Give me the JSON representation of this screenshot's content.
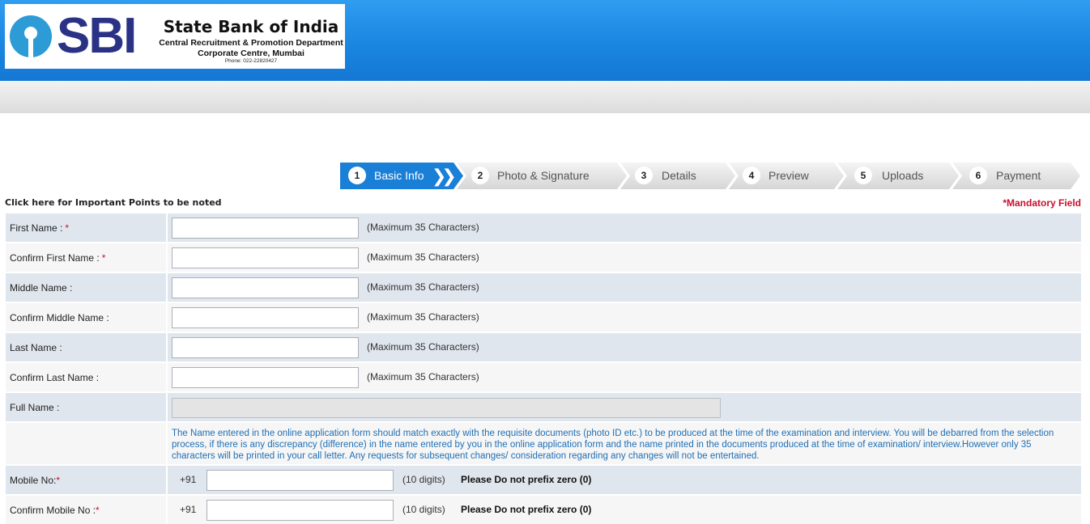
{
  "header": {
    "logo_text": "SBI",
    "bank_name": "State Bank of India",
    "department": "Central Recruitment & Promotion Department",
    "office": "Corporate Centre, Mumbai",
    "phone": "Phone: 022-22820427"
  },
  "steps": [
    {
      "num": "1",
      "label": "Basic Info",
      "active": true
    },
    {
      "num": "2",
      "label": "Photo & Signature",
      "active": false
    },
    {
      "num": "3",
      "label": "Details",
      "active": false
    },
    {
      "num": "4",
      "label": "Preview",
      "active": false
    },
    {
      "num": "5",
      "label": "Uploads",
      "active": false
    },
    {
      "num": "6",
      "label": "Payment",
      "active": false
    }
  ],
  "important_link": "Click here for Important Points to be noted",
  "mandatory_note": "*Mandatory Field",
  "form": {
    "first_name": {
      "label": "First Name :",
      "req": "*",
      "hint": "(Maximum 35 Characters)",
      "value": ""
    },
    "confirm_first_name": {
      "label": "Confirm First Name :",
      "req": "*",
      "hint": "(Maximum 35 Characters)",
      "value": ""
    },
    "middle_name": {
      "label": "Middle Name :",
      "hint": "(Maximum 35 Characters)",
      "value": ""
    },
    "confirm_middle_name": {
      "label": "Confirm Middle Name :",
      "hint": "(Maximum 35 Characters)",
      "value": ""
    },
    "last_name": {
      "label": "Last Name :",
      "hint": "(Maximum 35 Characters)",
      "value": ""
    },
    "confirm_last_name": {
      "label": "Confirm Last Name :",
      "hint": "(Maximum 35 Characters)",
      "value": ""
    },
    "full_name": {
      "label": "Full Name :",
      "value": ""
    },
    "name_note": "The Name entered in the online application form should match exactly with the requisite documents (photo ID etc.) to be produced at the time of the examination and interview. You will be debarred from the selection process, if there is any discrepancy (difference) in the name entered by you in the online application form and the name printed in the documents produced at the time of examination/ interview.However only 35 characters will be printed in your call letter. Any requests for subsequent changes/ consideration regarding any changes will not be entertained.",
    "mobile": {
      "label": "Mobile No:",
      "req": "*",
      "prefix": "+91",
      "digits": "(10 digits)",
      "warning": "Please Do not prefix zero (0)",
      "value": ""
    },
    "confirm_mobile": {
      "label": "Confirm Mobile No :",
      "req": "*",
      "prefix": "+91",
      "digits": "(10 digits)",
      "warning": "Please Do not prefix zero (0)",
      "value": ""
    }
  },
  "colors": {
    "header_blue": "#1a86e0",
    "active_step": "#1a7fd6",
    "mandatory_red": "#c8102e",
    "note_blue": "#1f6fb4"
  }
}
